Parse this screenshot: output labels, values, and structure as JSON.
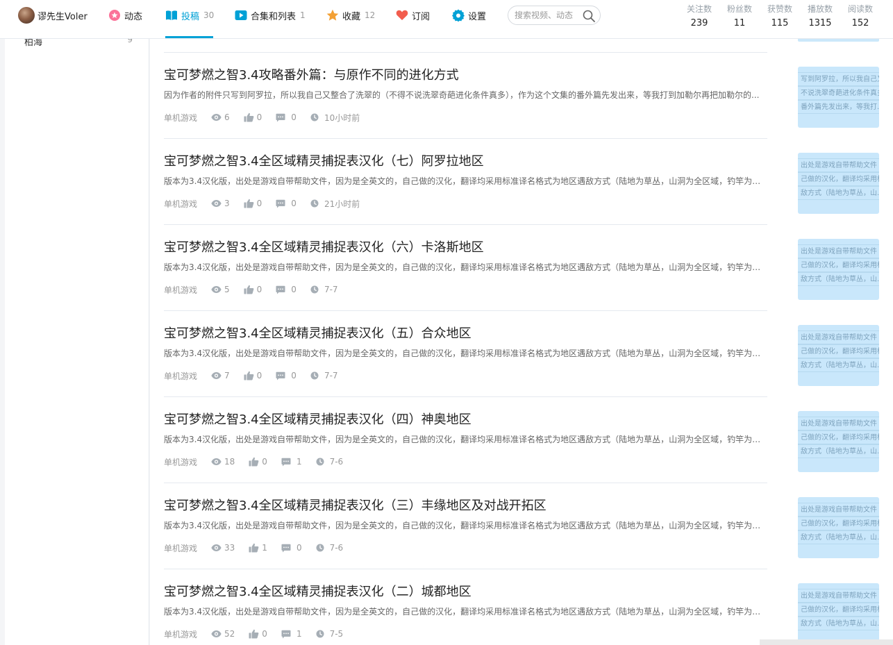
{
  "user": {
    "name": "谬先生Voler"
  },
  "nav": {
    "dynamic": {
      "label": "动态"
    },
    "contrib": {
      "label": "投稿",
      "count": "30"
    },
    "collection": {
      "label": "合集和列表",
      "count": "1"
    },
    "favorite": {
      "label": "收藏",
      "count": "12"
    },
    "subscribe": {
      "label": "订阅"
    },
    "settings": {
      "label": "设置"
    }
  },
  "search": {
    "placeholder": "搜索视频、动态"
  },
  "stats": [
    {
      "label": "关注数",
      "value": "239"
    },
    {
      "label": "粉丝数",
      "value": "11"
    },
    {
      "label": "获赞数",
      "value": "115"
    },
    {
      "label": "播放数",
      "value": "1315"
    },
    {
      "label": "阅读数",
      "value": "152"
    }
  ],
  "sidebar": {
    "item": {
      "name": "柏海",
      "count": "9"
    }
  },
  "articles": [
    {
      "title": "宝可梦燃之智3.4攻略番外篇：与原作不同的进化方式",
      "desc": "因为作者的附件只写到阿罗拉，所以我自己又整合了洗翠的（不得不说洗翠奇葩进化条件真多），作为这个文集的番外篇先发出来，等我打到加勒尔再把加勒尔的...",
      "category": "单机游戏",
      "views": "6",
      "likes": "0",
      "comments": "0",
      "time": "10小时前",
      "thumb": [
        "写到阿罗拉，所以我自己又",
        "不说洗翠奇葩进化条件真多",
        "番外篇先发出来，等我打..."
      ]
    },
    {
      "title": "宝可梦燃之智3.4全区域精灵捕捉表汉化（七）阿罗拉地区",
      "desc": "版本为3.4汉化版，出处是游戏自带帮助文件，因为是全英文的，自己做的汉化，翻译均采用标准译名格式为地区遇敌方式（陆地为草丛，山洞为全区域，钓竿为相...",
      "category": "单机游戏",
      "views": "3",
      "likes": "0",
      "comments": "0",
      "time": "21小时前",
      "thumb": [
        "出处是游戏自带帮助文件",
        "己做的汉化，翻译均采用标",
        "敌方式（陆地为草丛，山..."
      ]
    },
    {
      "title": "宝可梦燃之智3.4全区域精灵捕捉表汉化（六）卡洛斯地区",
      "desc": "版本为3.4汉化版，出处是游戏自带帮助文件，因为是全英文的，自己做的汉化，翻译均采用标准译名格式为地区遇敌方式（陆地为草丛，山洞为全区域，钓竿为相...",
      "category": "单机游戏",
      "views": "5",
      "likes": "0",
      "comments": "0",
      "time": "7-7",
      "thumb": [
        "出处是游戏自带帮助文件",
        "己做的汉化，翻译均采用标",
        "敌方式（陆地为草丛，山..."
      ]
    },
    {
      "title": "宝可梦燃之智3.4全区域精灵捕捉表汉化（五）合众地区",
      "desc": "版本为3.4汉化版，出处是游戏自带帮助文件，因为是全英文的，自己做的汉化，翻译均采用标准译名格式为地区遇敌方式（陆地为草丛，山洞为全区域，钓竿为相...",
      "category": "单机游戏",
      "views": "7",
      "likes": "0",
      "comments": "0",
      "time": "7-7",
      "thumb": [
        "出处是游戏自带帮助文件",
        "己做的汉化，翻译均采用标",
        "敌方式（陆地为草丛，山..."
      ]
    },
    {
      "title": "宝可梦燃之智3.4全区域精灵捕捉表汉化（四）神奥地区",
      "desc": "版本为3.4汉化版，出处是游戏自带帮助文件，因为是全英文的，自己做的汉化，翻译均采用标准译名格式为地区遇敌方式（陆地为草丛，山洞为全区域，钓竿为相...",
      "category": "单机游戏",
      "views": "18",
      "likes": "0",
      "comments": "1",
      "time": "7-6",
      "thumb": [
        "出处是游戏自带帮助文件",
        "己做的汉化，翻译均采用标",
        "敌方式（陆地为草丛，山..."
      ]
    },
    {
      "title": "宝可梦燃之智3.4全区域精灵捕捉表汉化（三）丰缘地区及对战开拓区",
      "desc": "版本为3.4汉化版，出处是游戏自带帮助文件，因为是全英文的，自己做的汉化，翻译均采用标准译名格式为地区遇敌方式（陆地为草丛，山洞为全区域，钓竿为相...",
      "category": "单机游戏",
      "views": "33",
      "likes": "1",
      "comments": "0",
      "time": "7-6",
      "thumb": [
        "出处是游戏自带帮助文件",
        "己做的汉化，翻译均采用标",
        "敌方式（陆地为草丛，山..."
      ]
    },
    {
      "title": "宝可梦燃之智3.4全区域精灵捕捉表汉化（二）城都地区",
      "desc": "版本为3.4汉化版，出处是游戏自带帮助文件，因为是全英文的，自己做的汉化，翻译均采用标准译名格式为地区遇敌方式（陆地为草丛，山洞为全区域，钓竿为相...",
      "category": "单机游戏",
      "views": "52",
      "likes": "0",
      "comments": "1",
      "time": "7-5",
      "thumb": [
        "出处是游戏自带帮助文件",
        "己做的汉化，翻译均采用标",
        "敌方式（陆地为草丛，山..."
      ]
    }
  ],
  "colors": {
    "accent": "#00a1d6",
    "dynamic": "#fb7299",
    "favorite": "#f3a034",
    "subscribe": "#f25d4e"
  }
}
